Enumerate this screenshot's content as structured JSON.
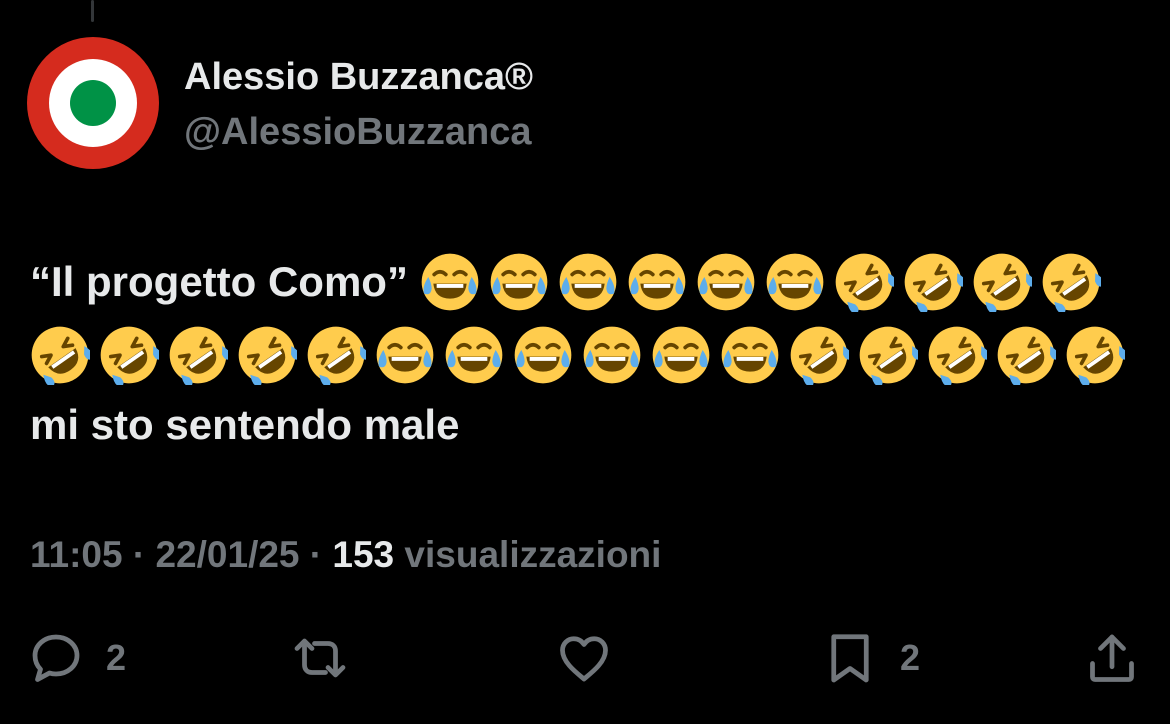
{
  "author": {
    "display_name": "Alessio Buzzanca®",
    "handle": "@AlessioBuzzanca",
    "avatar_icon": "italian-roundel-icon",
    "avatar_colors": {
      "outer": "#d52b1e",
      "middle": "#ffffff",
      "inner": "#009246"
    }
  },
  "tweet": {
    "segments": [
      {
        "type": "text",
        "value": "“Il progetto Como” "
      },
      {
        "type": "emoji",
        "icon": "face-with-tears-of-joy"
      },
      {
        "type": "emoji",
        "icon": "face-with-tears-of-joy"
      },
      {
        "type": "emoji",
        "icon": "face-with-tears-of-joy"
      },
      {
        "type": "emoji",
        "icon": "face-with-tears-of-joy"
      },
      {
        "type": "emoji",
        "icon": "face-with-tears-of-joy"
      },
      {
        "type": "emoji",
        "icon": "face-with-tears-of-joy"
      },
      {
        "type": "emoji",
        "icon": "rolling-on-the-floor-laughing"
      },
      {
        "type": "emoji",
        "icon": "rolling-on-the-floor-laughing"
      },
      {
        "type": "emoji",
        "icon": "rolling-on-the-floor-laughing"
      },
      {
        "type": "emoji",
        "icon": "rolling-on-the-floor-laughing"
      },
      {
        "type": "emoji",
        "icon": "rolling-on-the-floor-laughing"
      },
      {
        "type": "emoji",
        "icon": "rolling-on-the-floor-laughing"
      },
      {
        "type": "emoji",
        "icon": "rolling-on-the-floor-laughing"
      },
      {
        "type": "emoji",
        "icon": "rolling-on-the-floor-laughing"
      },
      {
        "type": "emoji",
        "icon": "rolling-on-the-floor-laughing"
      },
      {
        "type": "emoji",
        "icon": "face-with-tears-of-joy"
      },
      {
        "type": "emoji",
        "icon": "face-with-tears-of-joy"
      },
      {
        "type": "emoji",
        "icon": "face-with-tears-of-joy"
      },
      {
        "type": "emoji",
        "icon": "face-with-tears-of-joy"
      },
      {
        "type": "emoji",
        "icon": "face-with-tears-of-joy"
      },
      {
        "type": "emoji",
        "icon": "face-with-tears-of-joy"
      },
      {
        "type": "emoji",
        "icon": "rolling-on-the-floor-laughing"
      },
      {
        "type": "emoji",
        "icon": "rolling-on-the-floor-laughing"
      },
      {
        "type": "emoji",
        "icon": "rolling-on-the-floor-laughing"
      },
      {
        "type": "emoji",
        "icon": "rolling-on-the-floor-laughing"
      },
      {
        "type": "emoji",
        "icon": "rolling-on-the-floor-laughing"
      },
      {
        "type": "text",
        "value": " mi sto sentendo male"
      }
    ]
  },
  "meta": {
    "time": "11:05",
    "separator": " · ",
    "date": "22/01/25",
    "views_count": "153",
    "views_label": " visualizzazioni"
  },
  "actions": {
    "reply": {
      "icon": "reply-icon",
      "count": "2"
    },
    "retweet": {
      "icon": "retweet-icon",
      "count": ""
    },
    "like": {
      "icon": "heart-icon",
      "count": ""
    },
    "bookmark": {
      "icon": "bookmark-icon",
      "count": "2"
    },
    "share": {
      "icon": "share-icon",
      "count": ""
    }
  },
  "colors": {
    "background": "#000000",
    "primary_text": "#e7e9ea",
    "secondary_text": "#71767b",
    "emoji_face": "#ffcc4d",
    "emoji_tears": "#5dadec"
  }
}
